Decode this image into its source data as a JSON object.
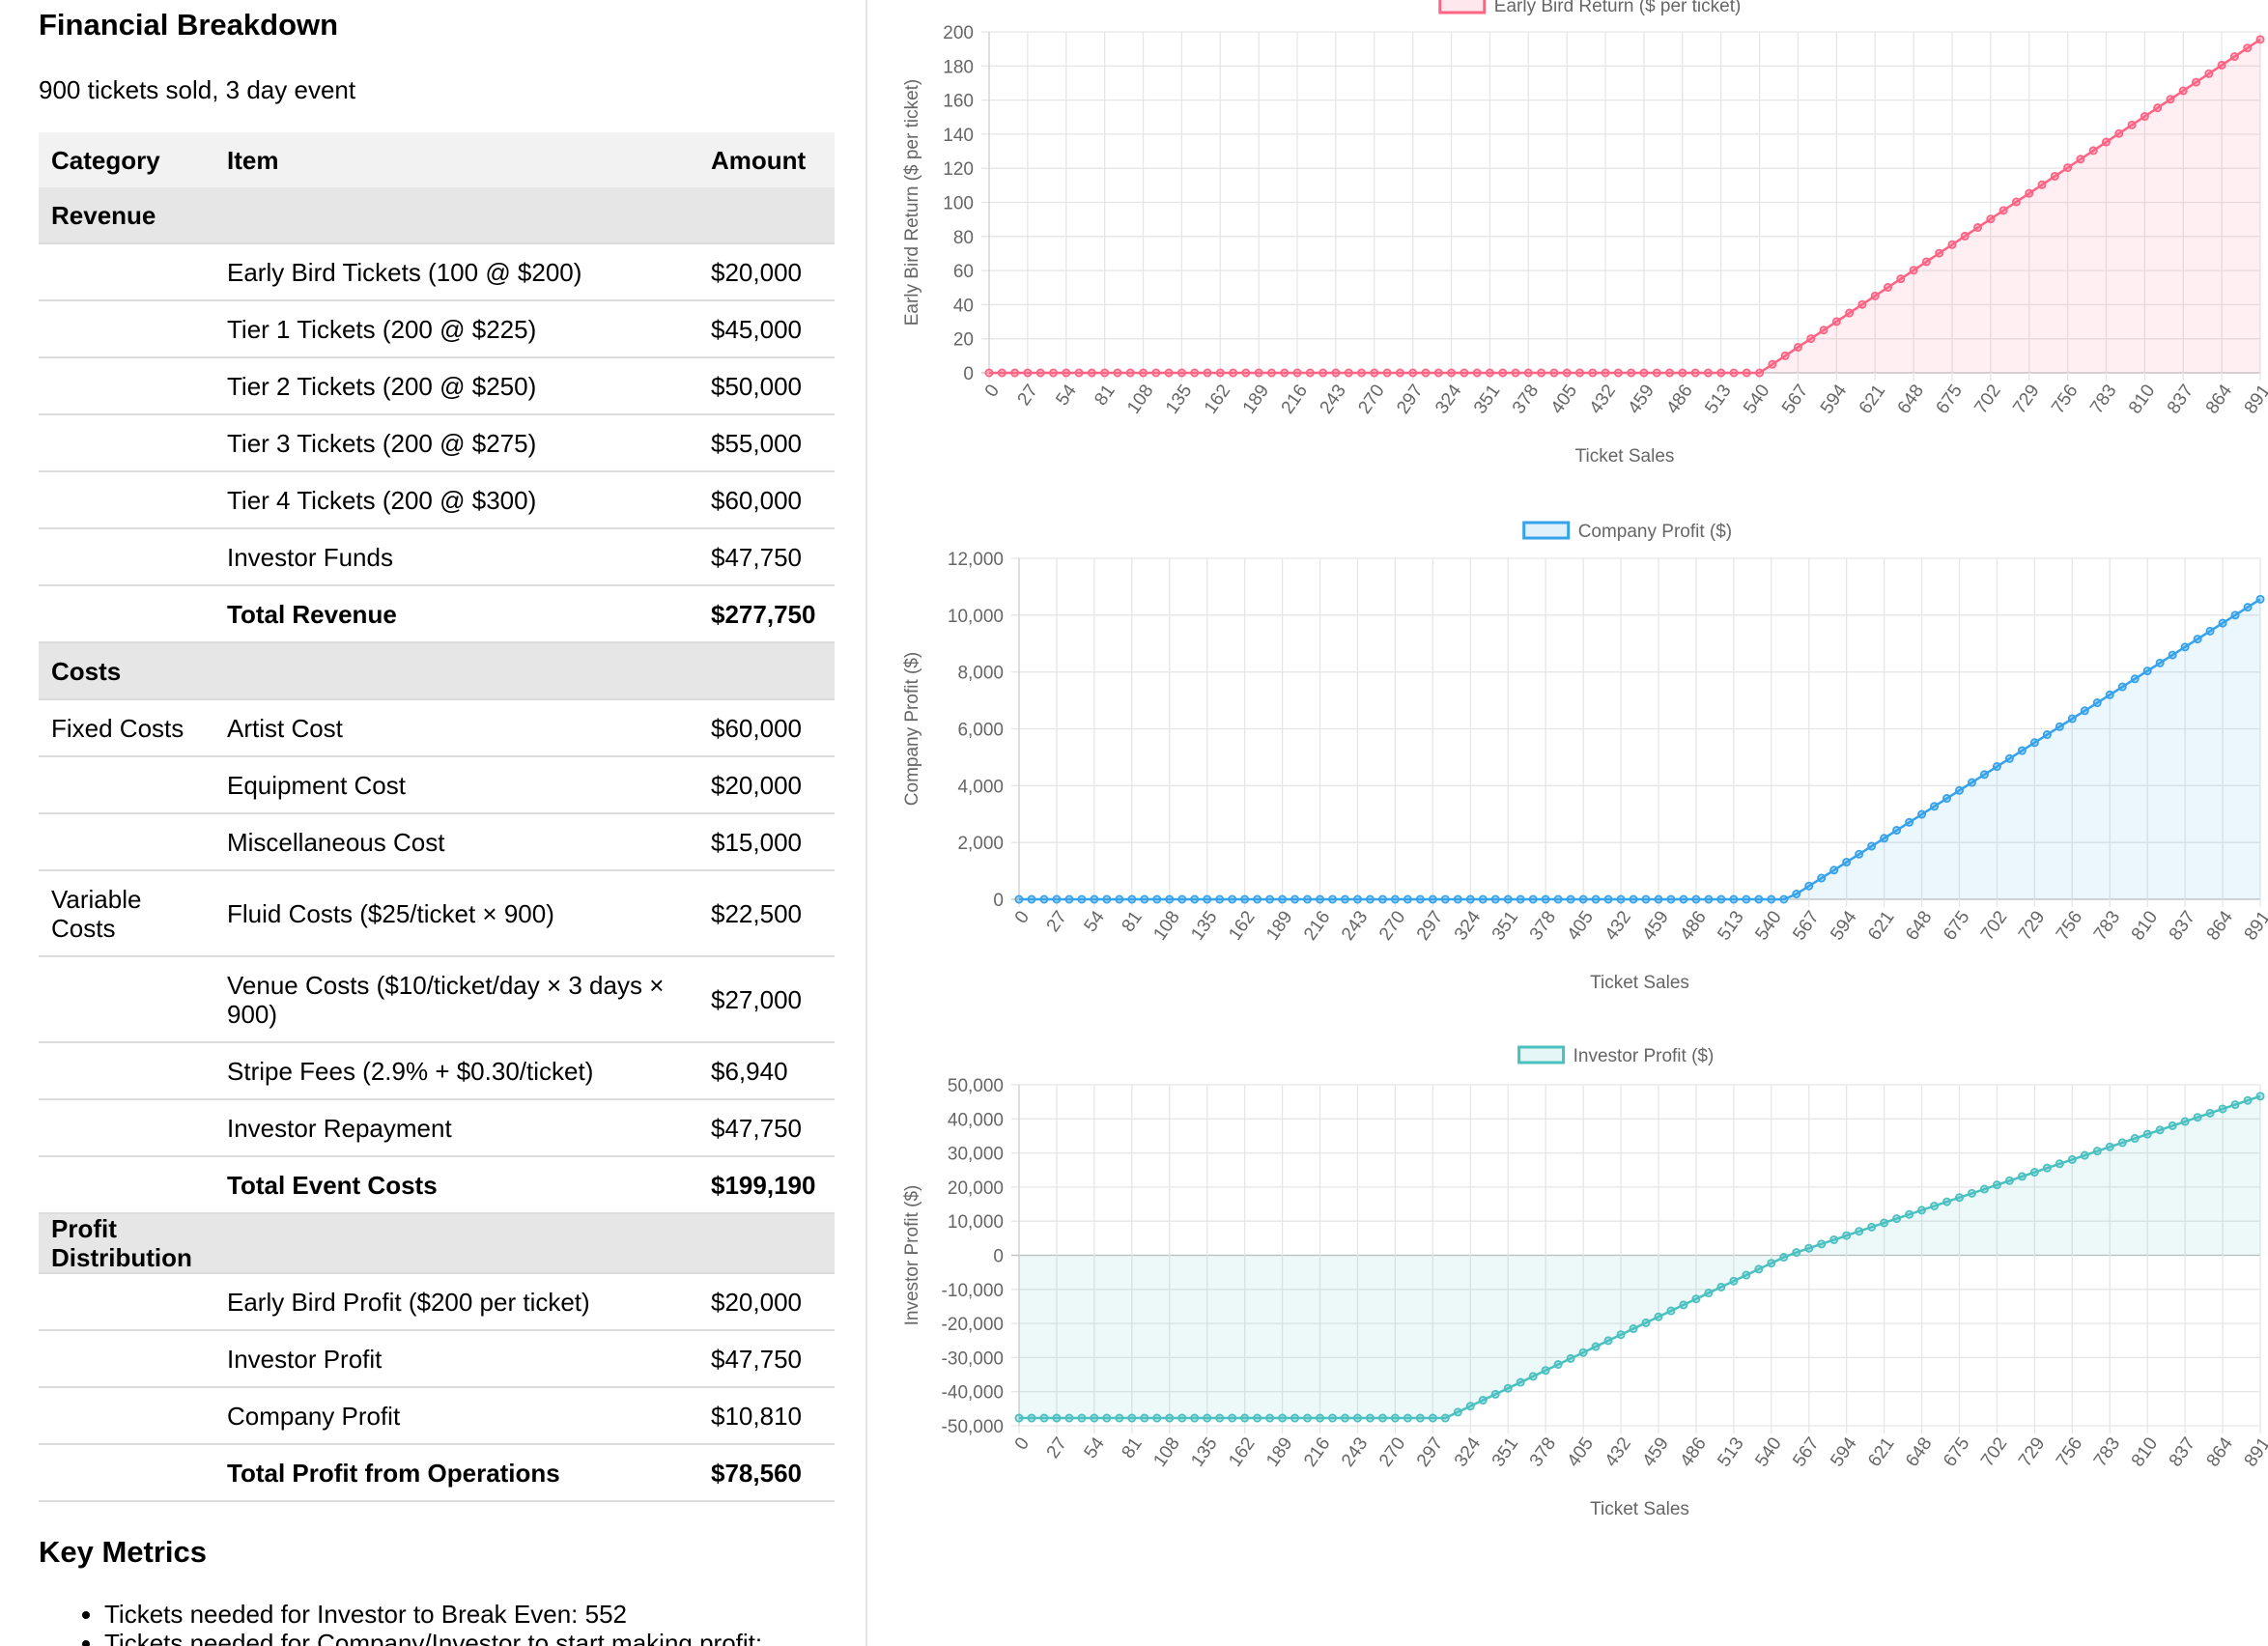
{
  "left": {
    "title": "Financial Breakdown",
    "subtitle": "900 tickets sold, 3 day event",
    "table": {
      "headers": [
        "Category",
        "Item",
        "Amount"
      ],
      "rows": [
        {
          "type": "section",
          "category": "Revenue",
          "item": "",
          "amount": ""
        },
        {
          "type": "item",
          "category": "",
          "item": "Early Bird Tickets (100 @ $200)",
          "amount": "$20,000"
        },
        {
          "type": "item",
          "category": "",
          "item": "Tier 1 Tickets (200 @ $225)",
          "amount": "$45,000"
        },
        {
          "type": "item",
          "category": "",
          "item": "Tier 2 Tickets (200 @ $250)",
          "amount": "$50,000"
        },
        {
          "type": "item",
          "category": "",
          "item": "Tier 3 Tickets (200 @ $275)",
          "amount": "$55,000"
        },
        {
          "type": "item",
          "category": "",
          "item": "Tier 4 Tickets (200 @ $300)",
          "amount": "$60,000"
        },
        {
          "type": "item",
          "category": "",
          "item": "Investor Funds",
          "amount": "$47,750"
        },
        {
          "type": "total",
          "category": "",
          "item": "Total Revenue",
          "amount": "$277,750"
        },
        {
          "type": "section",
          "category": "Costs",
          "item": "",
          "amount": ""
        },
        {
          "type": "item",
          "category": "Fixed Costs",
          "item": "Artist Cost",
          "amount": "$60,000"
        },
        {
          "type": "item",
          "category": "",
          "item": "Equipment Cost",
          "amount": "$20,000"
        },
        {
          "type": "item",
          "category": "",
          "item": "Miscellaneous Cost",
          "amount": "$15,000"
        },
        {
          "type": "tall",
          "category": "Variable Costs",
          "item": "Fluid Costs ($25/ticket × 900)",
          "amount": "$22,500"
        },
        {
          "type": "tall",
          "category": "",
          "item": "Venue Costs ($10/ticket/day × 3 days × 900)",
          "amount": "$27,000"
        },
        {
          "type": "item",
          "category": "",
          "item": "Stripe Fees (2.9% + $0.30/ticket)",
          "amount": "$6,940"
        },
        {
          "type": "item",
          "category": "",
          "item": "Investor Repayment",
          "amount": "$47,750"
        },
        {
          "type": "total",
          "category": "",
          "item": "Total Event Costs",
          "amount": "$199,190"
        },
        {
          "type": "section",
          "category": "Profit Distribution",
          "item": "",
          "amount": ""
        },
        {
          "type": "item",
          "category": "",
          "item": "Early Bird Profit ($200 per ticket)",
          "amount": "$20,000"
        },
        {
          "type": "item",
          "category": "",
          "item": "Investor Profit",
          "amount": "$47,750"
        },
        {
          "type": "item",
          "category": "",
          "item": "Company Profit",
          "amount": "$10,810"
        },
        {
          "type": "total",
          "category": "",
          "item": "Total Profit from Operations",
          "amount": "$78,560"
        }
      ]
    },
    "metrics_title": "Key Metrics",
    "metrics": [
      "Tickets needed for Investor to Break Even: 552",
      "Tickets needed for Company/Investor to start making profit:"
    ]
  },
  "chart_data": [
    {
      "type": "line",
      "fill": true,
      "legend": "Early Bird Return ($ per ticket)",
      "legend_position": "top",
      "xlabel": "Ticket Sales",
      "ylabel": "Early Bird Return ($ per ticket)",
      "color": "#ff6384",
      "x_start": 0,
      "x_end": 899,
      "x_step": 9,
      "x_tick_every": 3,
      "ylim": [
        0,
        200
      ],
      "y_step": 20,
      "grid": true,
      "breakpoints": [
        [
          0,
          0
        ],
        [
          540,
          0
        ],
        [
          899,
          200
        ]
      ]
    },
    {
      "type": "line",
      "fill": true,
      "legend": "Company Profit ($)",
      "legend_position": "top",
      "xlabel": "Ticket Sales",
      "ylabel": "Company Profit ($)",
      "color": "#36a2eb",
      "x_start": 0,
      "x_end": 899,
      "x_step": 9,
      "x_tick_every": 3,
      "ylim": [
        0,
        12000
      ],
      "y_step": 2000,
      "grid": true,
      "breakpoints": [
        [
          0,
          0
        ],
        [
          552,
          0
        ],
        [
          899,
          10810
        ]
      ]
    },
    {
      "type": "line",
      "fill": true,
      "legend": "Investor Profit ($)",
      "legend_position": "top",
      "xlabel": "Ticket Sales",
      "ylabel": "Investor Profit ($)",
      "color": "#4bc0c0",
      "x_start": 0,
      "x_end": 899,
      "x_step": 9,
      "x_tick_every": 3,
      "ylim": [
        -50000,
        50000
      ],
      "y_step": 10000,
      "grid": true,
      "breakpoints": [
        [
          0,
          -47750
        ],
        [
          306,
          -47750
        ],
        [
          552,
          0
        ],
        [
          899,
          47750
        ]
      ]
    }
  ]
}
